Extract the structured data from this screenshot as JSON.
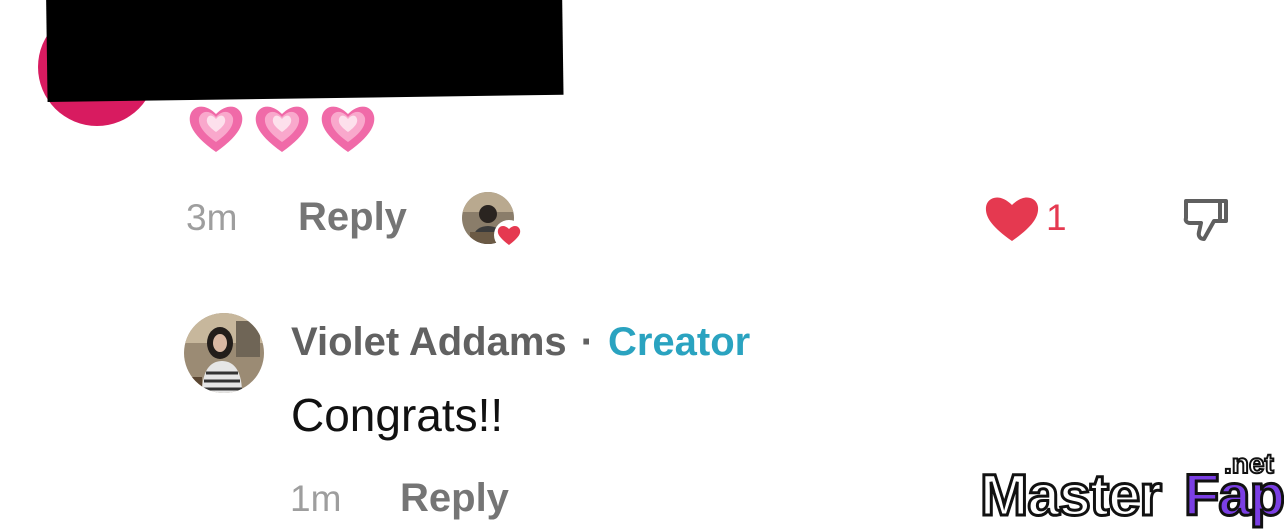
{
  "comment_1": {
    "time": "3m",
    "reply_label": "Reply",
    "like_count": "1",
    "emoji_icons": [
      "growing-heart-icon",
      "growing-heart-icon",
      "growing-heart-icon"
    ]
  },
  "comment_2": {
    "author": "Violet Addams",
    "separator": "·",
    "badge": "Creator",
    "text": "Congrats!!",
    "time": "1m",
    "reply_label": "Reply"
  },
  "watermark": {
    "part1": "Master",
    "part2": "Fap",
    "part3": ".net"
  },
  "colors": {
    "like_red": "#e53950",
    "creator_teal": "#2aa3c0",
    "avatar_pink": "#d81b60"
  }
}
